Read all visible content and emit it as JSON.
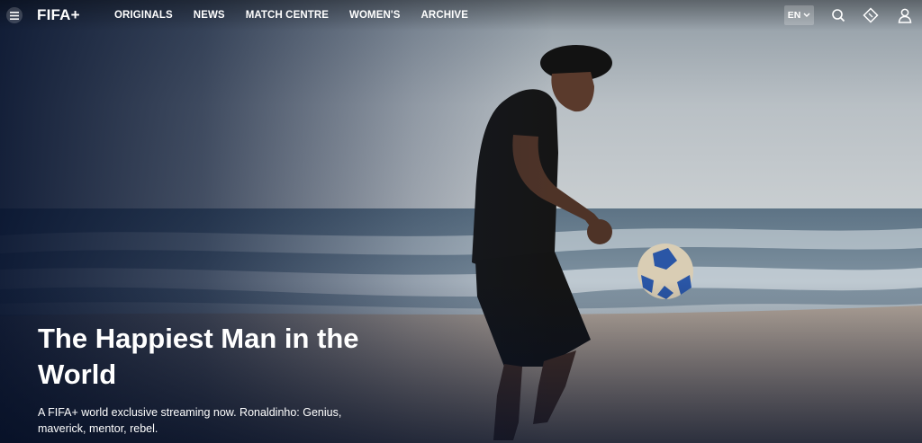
{
  "header": {
    "menu_icon": "hamburger-menu-icon",
    "logo_text": "FIFA+",
    "nav": [
      {
        "label": "ORIGINALS"
      },
      {
        "label": "NEWS"
      },
      {
        "label": "MATCH CENTRE"
      },
      {
        "label": "WOMEN'S"
      },
      {
        "label": "ARCHIVE"
      }
    ],
    "language": "EN",
    "icons": [
      "chevron-down-icon",
      "search-icon",
      "ticket-icon",
      "user-icon"
    ]
  },
  "hero": {
    "title": "The Happiest Man in the World",
    "subtitle": "A FIFA+ world exclusive streaming now. Ronaldinho: Genius, maverick, mentor, rebel."
  },
  "colors": {
    "nav_text": "#ffffff",
    "overlay": "#06122d",
    "sea": "#6c8294",
    "sand": "#b7a89b"
  }
}
